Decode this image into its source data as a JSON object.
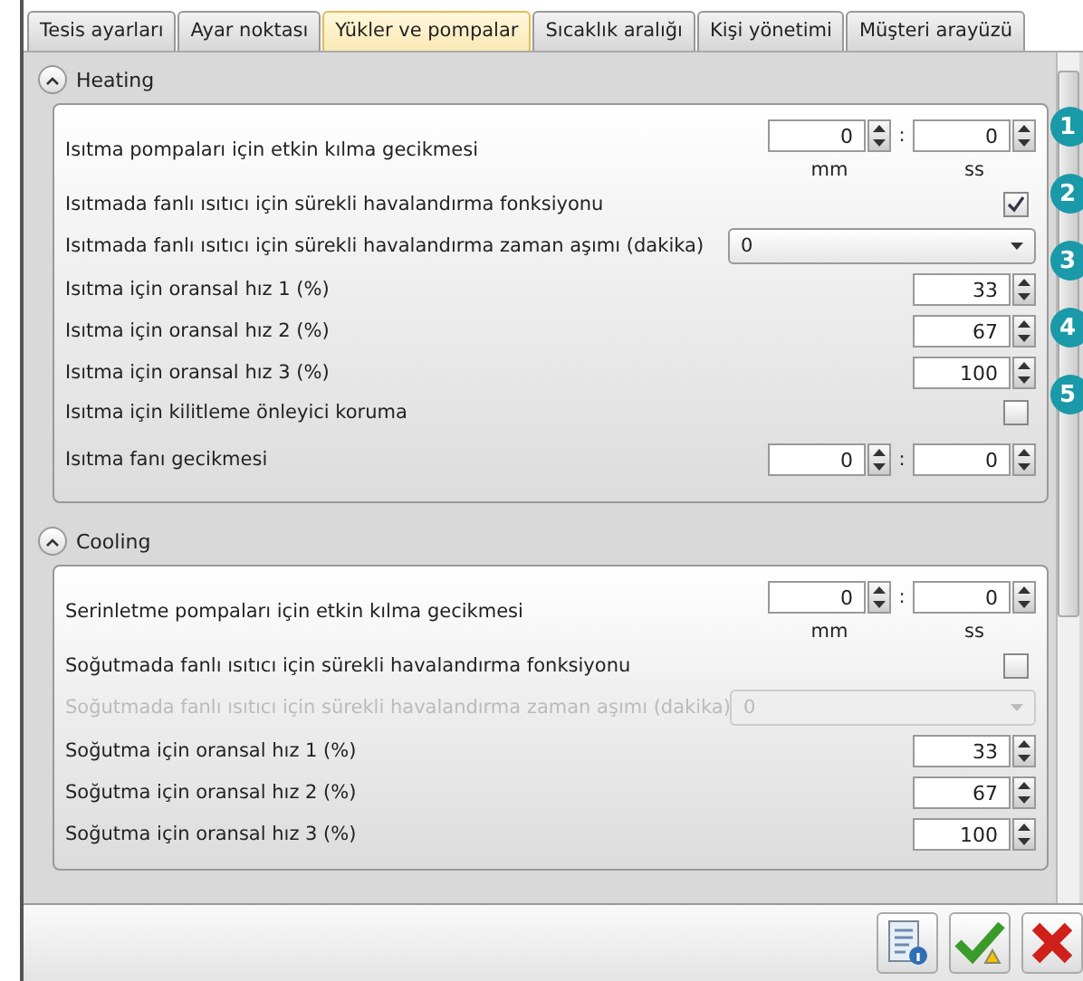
{
  "tabs": [
    {
      "label": "Tesis ayarları",
      "selected": false
    },
    {
      "label": "Ayar noktası",
      "selected": false
    },
    {
      "label": "Yükler ve pompalar",
      "selected": true
    },
    {
      "label": "Sıcaklık aralığı",
      "selected": false
    },
    {
      "label": "Kişi yönetimi",
      "selected": false
    },
    {
      "label": "Müşteri arayüzü",
      "selected": false
    }
  ],
  "sections": [
    {
      "title": "Heating",
      "expanded": true,
      "rows": [
        {
          "kind": "time",
          "label": "Isıtma pompaları için etkin kılma gecikmesi",
          "minutes": "0",
          "seconds": "0",
          "separator": ":",
          "minutes_unit": "mm",
          "seconds_unit": "ss"
        },
        {
          "kind": "check",
          "label": "Isıtmada fanlı ısıtıcı için sürekli havalandırma fonksiyonu",
          "checked": true
        },
        {
          "kind": "dropdown",
          "label": "Isıtmada fanlı ısıtıcı için sürekli havalandırma zaman aşımı (dakika)",
          "value": "0",
          "disabled": false
        },
        {
          "kind": "number",
          "label": "Isıtma için oransal hız 1 (%)",
          "value": "33"
        },
        {
          "kind": "number",
          "label": "Isıtma için oransal hız 2 (%)",
          "value": "67"
        },
        {
          "kind": "number",
          "label": "Isıtma için oransal hız 3 (%)",
          "value": "100"
        },
        {
          "kind": "check",
          "label": "Isıtma için kilitleme önleyici koruma",
          "checked": false
        },
        {
          "kind": "time",
          "label": "Isıtma fanı gecikmesi",
          "minutes": "0",
          "seconds": "0",
          "separator": ":"
        }
      ]
    },
    {
      "title": "Cooling",
      "expanded": true,
      "rows": [
        {
          "kind": "time",
          "label": "Serinletme pompaları için etkin kılma gecikmesi",
          "minutes": "0",
          "seconds": "0",
          "separator": ":",
          "minutes_unit": "mm",
          "seconds_unit": "ss"
        },
        {
          "kind": "check",
          "label": "Soğutmada fanlı ısıtıcı için sürekli havalandırma fonksiyonu",
          "checked": false
        },
        {
          "kind": "dropdown",
          "label": "Soğutmada fanlı ısıtıcı için sürekli havalandırma zaman aşımı (dakika)",
          "value": "0",
          "disabled": true
        },
        {
          "kind": "number",
          "label": "Soğutma için oransal hız 1 (%)",
          "value": "33"
        },
        {
          "kind": "number",
          "label": "Soğutma için oransal hız 2 (%)",
          "value": "67"
        },
        {
          "kind": "number",
          "label": "Soğutma için oransal hız 3 (%)",
          "value": "100"
        }
      ]
    }
  ],
  "callouts": [
    "1",
    "2",
    "3",
    "4",
    "5"
  ]
}
